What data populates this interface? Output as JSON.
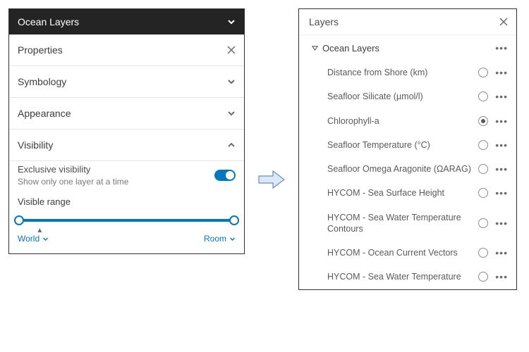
{
  "left": {
    "title": "Ocean Layers",
    "properties_label": "Properties",
    "sections": {
      "symbology": "Symbology",
      "appearance": "Appearance",
      "visibility": "Visibility"
    },
    "exclusive": {
      "title": "Exclusive visibility",
      "subtitle": "Show only one layer at a time",
      "enabled": true
    },
    "range": {
      "label": "Visible range",
      "min_label": "World",
      "max_label": "Room"
    }
  },
  "right": {
    "title": "Layers",
    "group": "Ocean Layers",
    "layers": [
      {
        "name": "Distance from Shore (km)",
        "selected": false
      },
      {
        "name": "Seafloor Silicate (µmol/l)",
        "selected": false
      },
      {
        "name": "Chlorophyll-a",
        "selected": true
      },
      {
        "name": "Seafloor Temperature (°C)",
        "selected": false
      },
      {
        "name": "Seafloor Omega Aragonite (ΩARAG)",
        "selected": false
      },
      {
        "name": "HYCOM - Sea Surface Height",
        "selected": false
      },
      {
        "name": "HYCOM - Sea Water Temperature Contours",
        "selected": false
      },
      {
        "name": "HYCOM - Ocean Current Vectors",
        "selected": false
      },
      {
        "name": "HYCOM - Sea Water Temperature",
        "selected": false
      }
    ]
  }
}
